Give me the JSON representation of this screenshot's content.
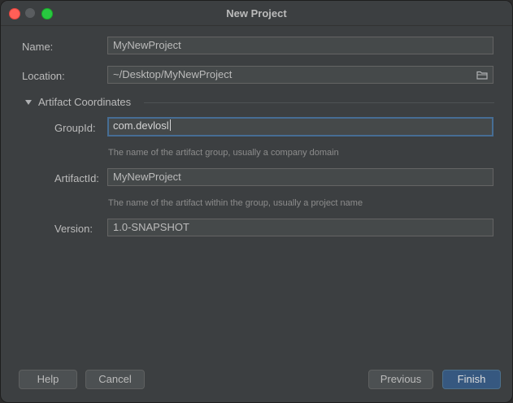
{
  "window": {
    "title": "New Project"
  },
  "form": {
    "name_label": "Name:",
    "name_value": "MyNewProject",
    "location_label": "Location:",
    "location_value": "~/Desktop/MyNewProject",
    "section_title": "Artifact Coordinates",
    "groupid_label": "GroupId:",
    "groupid_value": "com.devlosl",
    "groupid_hint": "The name of the artifact group, usually a company domain",
    "artifactid_label": "ArtifactId:",
    "artifactid_value": "MyNewProject",
    "artifactid_hint": "The name of the artifact within the group, usually a project name",
    "version_label": "Version:",
    "version_value": "1.0-SNAPSHOT"
  },
  "buttons": {
    "help": "Help",
    "cancel": "Cancel",
    "previous": "Previous",
    "finish": "Finish"
  },
  "colors": {
    "background": "#3c3f41",
    "field": "#45494a",
    "focus": "#466d94",
    "default_button": "#365880"
  },
  "icons": [
    "folder-icon",
    "triangle-down-icon",
    "close-icon",
    "minimize-icon",
    "maximize-icon"
  ]
}
